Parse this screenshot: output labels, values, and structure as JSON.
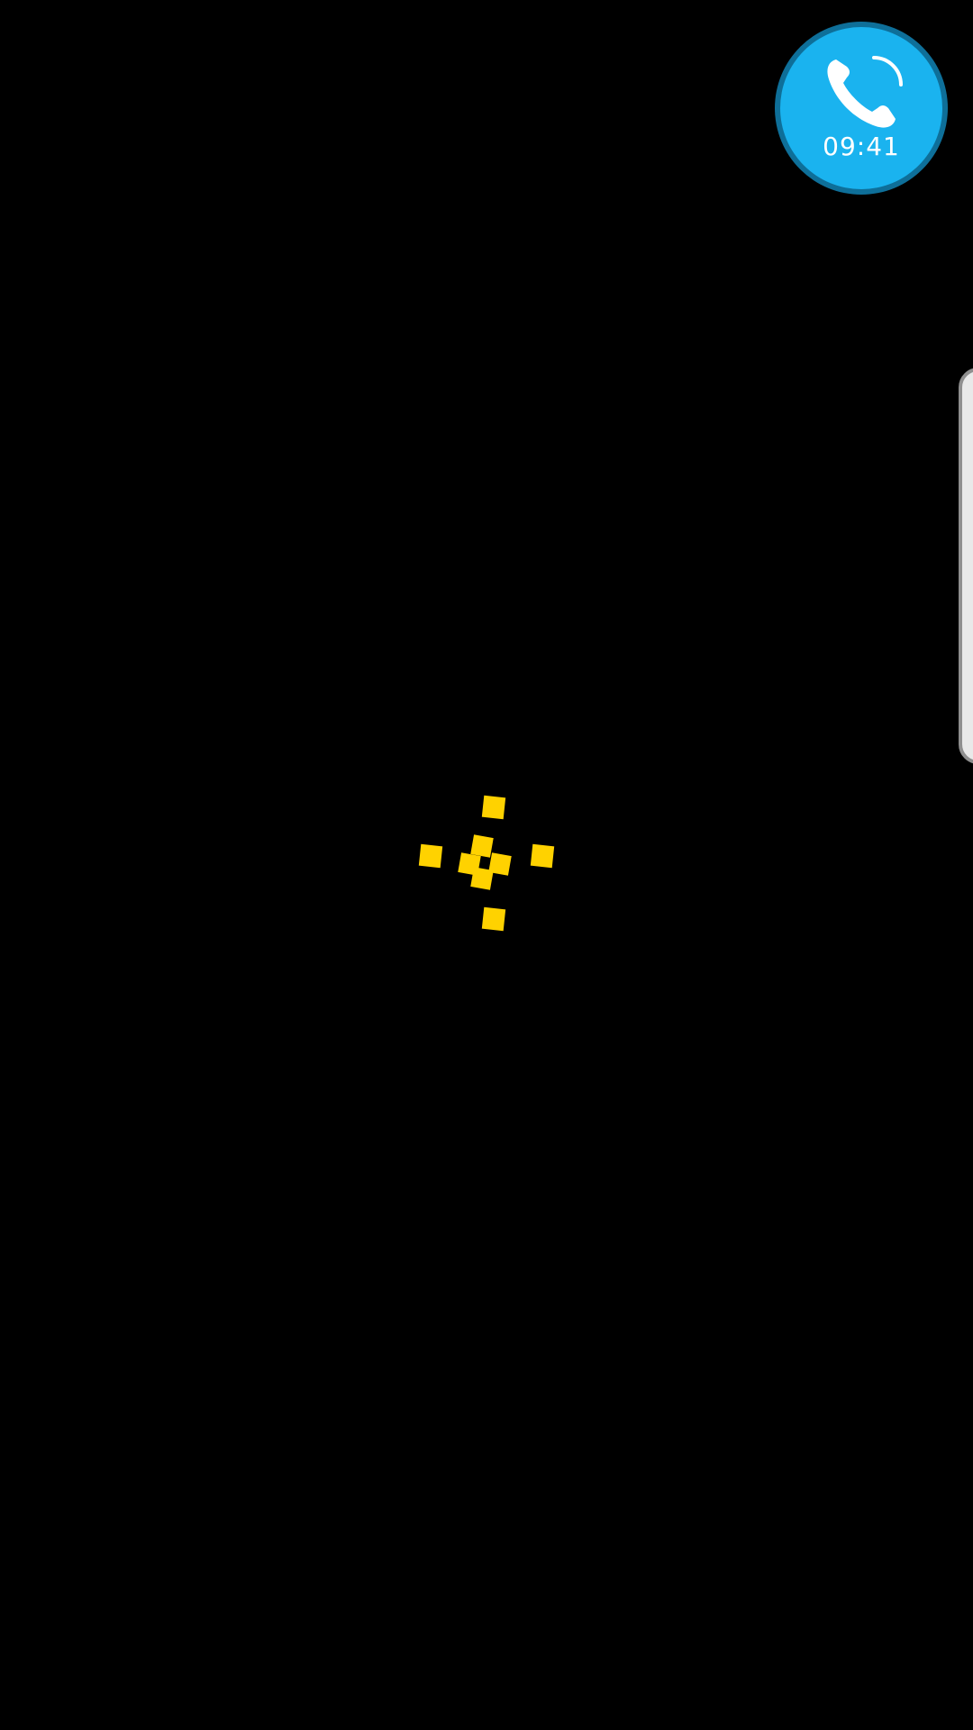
{
  "call_bubble": {
    "timer": "09:41",
    "icon": "phone-icon",
    "color": "#1ab3ef"
  },
  "edge_panel": {
    "icon": "edge-panel-handle"
  },
  "loader": {
    "icon": "loading-spinner-icon",
    "color": "#ffd200"
  }
}
